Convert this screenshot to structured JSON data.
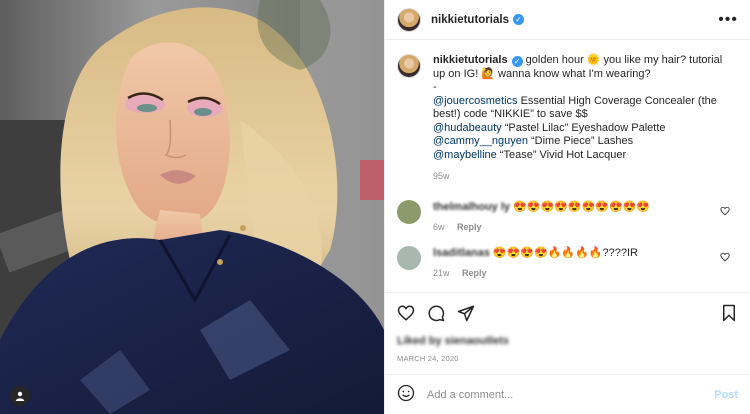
{
  "header": {
    "username": "nikkietutorials",
    "verified_icon": "verified-badge-icon",
    "more_icon": "more-options-icon",
    "more_label": "•••"
  },
  "caption": {
    "username": "nikkietutorials",
    "line1": "golden hour 🌞 you like my hair? tutorial up on IG! 🙋 wanna know what I'm wearing?",
    "dash": "-",
    "items": [
      {
        "mention": "@jouercosmetics",
        "text": " Essential High Coverage Concealer (the best!) code “NIKKIE” to save $$"
      },
      {
        "mention": "@hudabeauty",
        "text": " “Pastel Lilac” Eyeshadow Palette"
      },
      {
        "mention": "@cammy__nguyen",
        "text": " “Dime Piece” Lashes"
      },
      {
        "mention": "@maybelline",
        "text": " “Tease” Vivid Hot Lacquer"
      }
    ],
    "age": "95w"
  },
  "comments": [
    {
      "username": "thelmalhouy ly",
      "text": "😍😍😍😍😍😍😍😍😍😍",
      "age": "6w",
      "reply": "Reply",
      "avatar_color": "#8a9a6a"
    },
    {
      "username": "lsaditlanas",
      "text": "😍😍😍😍🔥🔥🔥🔥????IR",
      "age": "21w",
      "reply": "Reply",
      "avatar_color": "#a8b8b0"
    }
  ],
  "actions": {
    "like_icon": "heart-icon",
    "comment_icon": "comment-icon",
    "share_icon": "share-icon",
    "save_icon": "bookmark-icon"
  },
  "likes": {
    "text": "Liked by sienaoutlets"
  },
  "date": "MARCH 24, 2020",
  "add_comment": {
    "emoji_icon": "emoji-icon",
    "placeholder": "Add a comment...",
    "post_label": "Post"
  },
  "photo": {
    "tag_icon": "user-tag-icon"
  },
  "colors": {
    "link": "#00376b",
    "verified": "#3897f0",
    "muted": "#8e8e8e",
    "post_button": "#b3dbff"
  }
}
